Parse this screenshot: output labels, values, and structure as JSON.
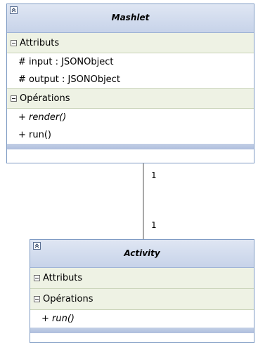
{
  "classes": {
    "mashlet": {
      "name": "Mashlet",
      "attributes_label": "Attributs",
      "attributes": [
        "# input : JSONObject",
        "# output : JSONObject"
      ],
      "operations_label": "Opérations",
      "operations": [
        "+ render()",
        "+ run()"
      ]
    },
    "activity": {
      "name": "Activity",
      "attributes_label": "Attributs",
      "operations_label": "Opérations",
      "operations": [
        "+ run()"
      ]
    }
  },
  "association": {
    "source_multiplicity": "1",
    "target_multiplicity": "1"
  },
  "icons": {
    "collapse": "double-chevron-up-icon",
    "section_toggle": "minus-box-icon"
  }
}
